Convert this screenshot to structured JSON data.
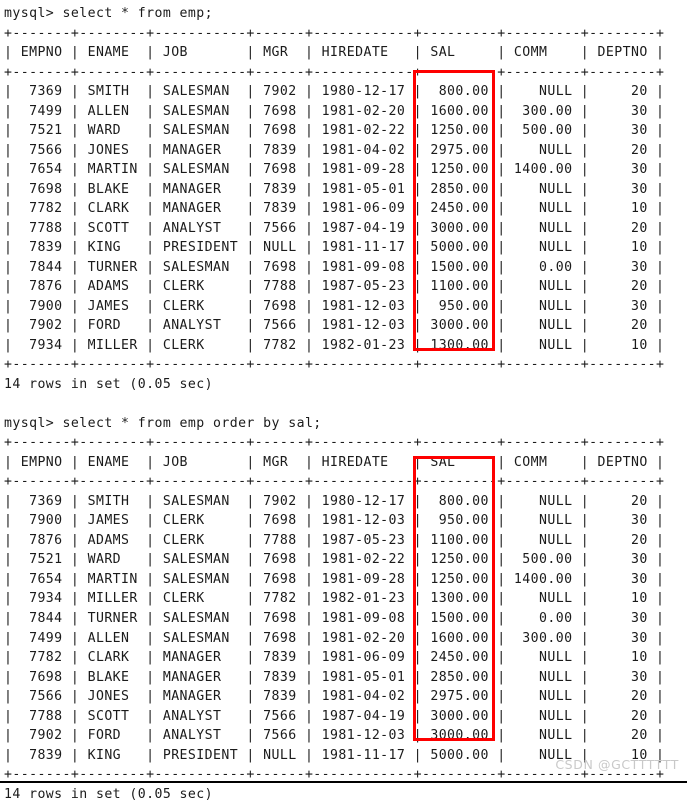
{
  "terminal": {
    "prompt": "mysql>",
    "separator_row": "+-------+--------+-----------+------+------------+---------+---------+--------+",
    "header_row": "| EMPNO | ENAME  | JOB       | MGR  | HIREDATE   | SAL     | COMM    | DEPTNO |"
  },
  "queries": [
    {
      "command_line": "mysql> select * from emp;",
      "command_text": "select * from emp;",
      "status": "14 rows in set (0.05 sec)",
      "row_count": 14,
      "elapsed": "0.05 sec",
      "columns": [
        "EMPNO",
        "ENAME",
        "JOB",
        "MGR",
        "HIREDATE",
        "SAL",
        "COMM",
        "DEPTNO"
      ],
      "rows": [
        [
          "7369",
          "SMITH",
          "SALESMAN",
          "7902",
          "1980-12-17",
          "800.00",
          "NULL",
          "20"
        ],
        [
          "7499",
          "ALLEN",
          "SALESMAN",
          "7698",
          "1981-02-20",
          "1600.00",
          "300.00",
          "30"
        ],
        [
          "7521",
          "WARD",
          "SALESMAN",
          "7698",
          "1981-02-22",
          "1250.00",
          "500.00",
          "30"
        ],
        [
          "7566",
          "JONES",
          "MANAGER",
          "7839",
          "1981-04-02",
          "2975.00",
          "NULL",
          "20"
        ],
        [
          "7654",
          "MARTIN",
          "SALESMAN",
          "7698",
          "1981-09-28",
          "1250.00",
          "1400.00",
          "30"
        ],
        [
          "7698",
          "BLAKE",
          "MANAGER",
          "7839",
          "1981-05-01",
          "2850.00",
          "NULL",
          "30"
        ],
        [
          "7782",
          "CLARK",
          "MANAGER",
          "7839",
          "1981-06-09",
          "2450.00",
          "NULL",
          "10"
        ],
        [
          "7788",
          "SCOTT",
          "ANALYST",
          "7566",
          "1987-04-19",
          "3000.00",
          "NULL",
          "20"
        ],
        [
          "7839",
          "KING",
          "PRESIDENT",
          "NULL",
          "1981-11-17",
          "5000.00",
          "NULL",
          "10"
        ],
        [
          "7844",
          "TURNER",
          "SALESMAN",
          "7698",
          "1981-09-08",
          "1500.00",
          "0.00",
          "30"
        ],
        [
          "7876",
          "ADAMS",
          "CLERK",
          "7788",
          "1987-05-23",
          "1100.00",
          "NULL",
          "20"
        ],
        [
          "7900",
          "JAMES",
          "CLERK",
          "7698",
          "1981-12-03",
          "950.00",
          "NULL",
          "30"
        ],
        [
          "7902",
          "FORD",
          "ANALYST",
          "7566",
          "1981-12-03",
          "3000.00",
          "NULL",
          "20"
        ],
        [
          "7934",
          "MILLER",
          "CLERK",
          "7782",
          "1982-01-23",
          "1300.00",
          "NULL",
          "10"
        ]
      ]
    },
    {
      "command_line": "mysql> select * from emp order by sal;",
      "command_text": "select * from emp order by sal;",
      "status": "14 rows in set (0.05 sec)",
      "row_count": 14,
      "elapsed": "0.05 sec",
      "columns": [
        "EMPNO",
        "ENAME",
        "JOB",
        "MGR",
        "HIREDATE",
        "SAL",
        "COMM",
        "DEPTNO"
      ],
      "rows": [
        [
          "7369",
          "SMITH",
          "SALESMAN",
          "7902",
          "1980-12-17",
          "800.00",
          "NULL",
          "20"
        ],
        [
          "7900",
          "JAMES",
          "CLERK",
          "7698",
          "1981-12-03",
          "950.00",
          "NULL",
          "30"
        ],
        [
          "7876",
          "ADAMS",
          "CLERK",
          "7788",
          "1987-05-23",
          "1100.00",
          "NULL",
          "20"
        ],
        [
          "7521",
          "WARD",
          "SALESMAN",
          "7698",
          "1981-02-22",
          "1250.00",
          "500.00",
          "30"
        ],
        [
          "7654",
          "MARTIN",
          "SALESMAN",
          "7698",
          "1981-09-28",
          "1250.00",
          "1400.00",
          "30"
        ],
        [
          "7934",
          "MILLER",
          "CLERK",
          "7782",
          "1982-01-23",
          "1300.00",
          "NULL",
          "10"
        ],
        [
          "7844",
          "TURNER",
          "SALESMAN",
          "7698",
          "1981-09-08",
          "1500.00",
          "0.00",
          "30"
        ],
        [
          "7499",
          "ALLEN",
          "SALESMAN",
          "7698",
          "1981-02-20",
          "1600.00",
          "300.00",
          "30"
        ],
        [
          "7782",
          "CLARK",
          "MANAGER",
          "7839",
          "1981-06-09",
          "2450.00",
          "NULL",
          "10"
        ],
        [
          "7698",
          "BLAKE",
          "MANAGER",
          "7839",
          "1981-05-01",
          "2850.00",
          "NULL",
          "30"
        ],
        [
          "7566",
          "JONES",
          "MANAGER",
          "7839",
          "1981-04-02",
          "2975.00",
          "NULL",
          "20"
        ],
        [
          "7788",
          "SCOTT",
          "ANALYST",
          "7566",
          "1987-04-19",
          "3000.00",
          "NULL",
          "20"
        ],
        [
          "7902",
          "FORD",
          "ANALYST",
          "7566",
          "1981-12-03",
          "3000.00",
          "NULL",
          "20"
        ],
        [
          "7839",
          "KING",
          "PRESIDENT",
          "NULL",
          "1981-11-17",
          "5000.00",
          "NULL",
          "10"
        ]
      ]
    }
  ],
  "annotations": {
    "highlight_color": "#fe0000",
    "highlight_target_column": "SAL",
    "boxes": [
      {
        "label": "sal-column-highlight-query-1"
      },
      {
        "label": "sal-column-highlight-query-2"
      }
    ]
  },
  "watermark": {
    "text": "CSDN @GCTTTTTT",
    "color": "#c9c9c9"
  }
}
